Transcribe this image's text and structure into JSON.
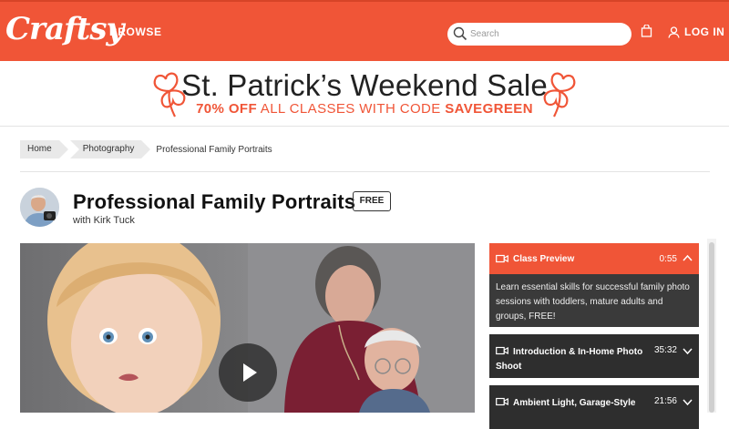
{
  "header": {
    "logo": "Craftsy",
    "browse_label": "BROWSE",
    "search_placeholder": "Search",
    "login_label": "LOG IN",
    "brand_color": "#f05537"
  },
  "banner": {
    "title": "St. Patrick’s Weekend Sale",
    "sub_discount": "70% OFF",
    "sub_middle": " ALL CLASSES WITH CODE ",
    "sub_code": "SAVEGREEN"
  },
  "breadcrumb": {
    "items": [
      "Home",
      "Photography"
    ],
    "current": "Professional Family Portraits"
  },
  "class": {
    "title": "Professional Family Portraits",
    "badge": "FREE",
    "instructor": "with Kirk Tuck"
  },
  "lessons": {
    "preview": {
      "name": "Class Preview",
      "duration": "0:55",
      "description": "Learn essential skills for successful family photo sessions with toddlers, mature adults and groups, FREE!"
    },
    "items": [
      {
        "name": "Introduction & In-Home Photo Shoot",
        "duration": "35:32"
      },
      {
        "name": "Ambient Light, Garage-Style",
        "duration": "21:56"
      }
    ]
  },
  "icons": [
    "search-icon",
    "bag-icon",
    "user-icon",
    "clover-icon",
    "video-camera-icon",
    "chevron-up-icon",
    "chevron-down-icon",
    "play-icon"
  ]
}
